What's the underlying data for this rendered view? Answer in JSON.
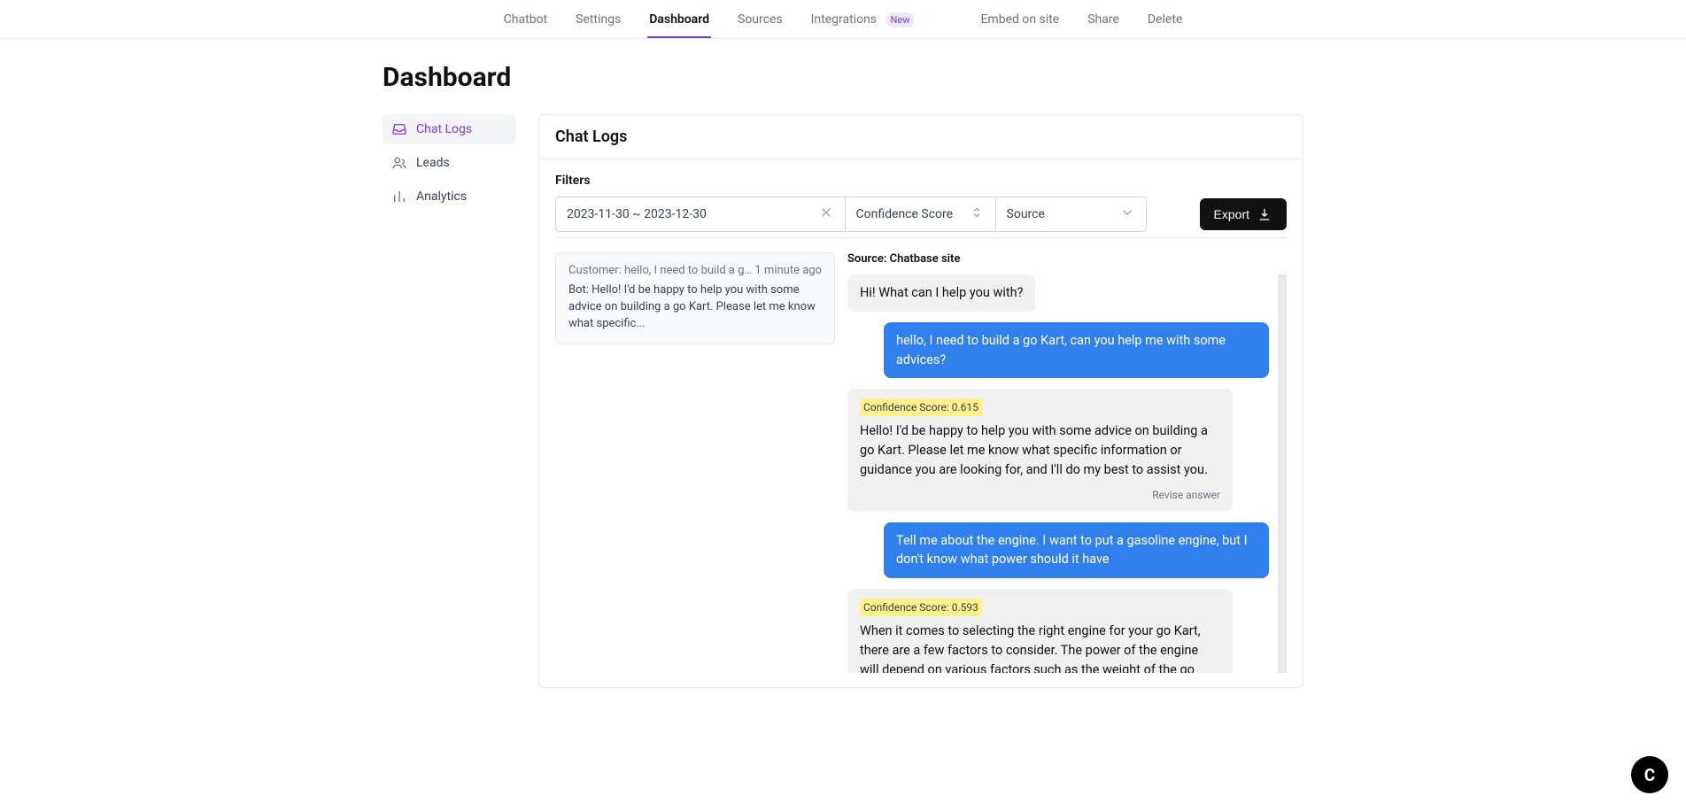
{
  "nav": {
    "tabs": [
      "Chatbot",
      "Settings",
      "Dashboard",
      "Sources",
      "Integrations"
    ],
    "badge": "New",
    "actions": [
      "Embed on site",
      "Share",
      "Delete"
    ],
    "active": "Dashboard"
  },
  "page_title": "Dashboard",
  "sidebar": {
    "items": [
      {
        "label": "Chat Logs",
        "active": true
      },
      {
        "label": "Leads",
        "active": false
      },
      {
        "label": "Analytics",
        "active": false
      }
    ]
  },
  "panel": {
    "title": "Chat Logs",
    "filters_label": "Filters",
    "date_range": "2023-11-30 ~ 2023-12-30",
    "confidence_label": "Confidence Score",
    "source_label": "Source",
    "export_label": "Export"
  },
  "log_list": [
    {
      "customer_line": "Customer: hello, I need to build a go Ka...",
      "time": "1 minute ago",
      "bot_line": "Bot: Hello! I'd be happy to help you with some advice on building a go Kart. Please let me know what specific..."
    }
  ],
  "chat": {
    "source_line": "Source: Chatbase site",
    "messages": [
      {
        "role": "bot",
        "text": "Hi! What can I help you with?"
      },
      {
        "role": "user",
        "text": "hello, I need to build a go Kart, can you help me with some advices?"
      },
      {
        "role": "bot",
        "confidence": "Confidence Score: 0.615",
        "text": "Hello! I'd be happy to help you with some advice on building a go Kart. Please let me know what specific information or guidance you are looking for, and I'll do my best to assist you.",
        "revise": "Revise answer"
      },
      {
        "role": "user",
        "text": "Tell me about the engine. I want to put a gasoline engine, but I don't know what power should it have"
      },
      {
        "role": "bot",
        "confidence": "Confidence Score: 0.593",
        "text": "When it comes to selecting the right engine for your go Kart, there are a few factors to consider. The power of the engine will depend on various factors such as the weight of the go Kart, the terrain you'll be driving on, and your desired speed."
      }
    ]
  },
  "float_button": "C"
}
